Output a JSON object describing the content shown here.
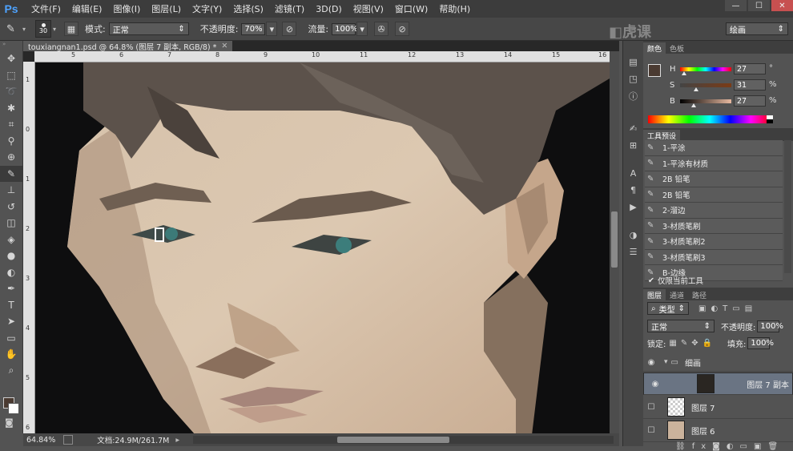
{
  "app": {
    "logo": "Ps"
  },
  "menu": [
    "文件(F)",
    "编辑(E)",
    "图像(I)",
    "图层(L)",
    "文字(Y)",
    "选择(S)",
    "滤镜(T)",
    "3D(D)",
    "视图(V)",
    "窗口(W)",
    "帮助(H)"
  ],
  "window_controls": [
    "—",
    "☐",
    "✕"
  ],
  "options": {
    "brush_size": "30",
    "mode_label": "模式:",
    "mode_value": "正常",
    "opacity_label": "不透明度:",
    "opacity_value": "70%",
    "flow_label": "流量:",
    "flow_value": "100%",
    "workspace": "绘画"
  },
  "document": {
    "tab_title": "touxiangnan1.psd @ 64.8% (图层 7 副本, RGB/8) *",
    "ruler_h": [
      "5",
      "6",
      "7",
      "8",
      "9",
      "10",
      "11",
      "12",
      "13",
      "14",
      "15",
      "16"
    ],
    "ruler_v": [
      "1",
      "0",
      "1",
      "2",
      "3",
      "4",
      "5",
      "6"
    ]
  },
  "status": {
    "zoom": "64.84%",
    "doc_size": "文档:24.9M/261.7M"
  },
  "color_panel": {
    "tabs": [
      "颜色",
      "色板"
    ],
    "h": {
      "label": "H",
      "value": "27",
      "unit": "°",
      "fraction": 0.08
    },
    "s": {
      "label": "S",
      "value": "31",
      "unit": "%",
      "fraction": 0.31
    },
    "b": {
      "label": "B",
      "value": "27",
      "unit": "%",
      "fraction": 0.27
    },
    "foreground": "#4a3a31"
  },
  "tool_presets": {
    "title": "工具预设",
    "items": [
      "1-平涂",
      "1-平涂有材质",
      "2B 铅笔",
      "2B 铅笔",
      "2-溜边",
      "3-材质笔刷",
      "3-材质笔刷2",
      "3-材质笔刷3",
      "B-边缘"
    ],
    "current_only": "仅限当前工具"
  },
  "layers_panel": {
    "tabs": [
      "图层",
      "通道",
      "路径"
    ],
    "filter": "类型",
    "blend": "正常",
    "opacity_label": "不透明度:",
    "opacity_value": "100%",
    "lock_label": "锁定:",
    "fill_label": "填充:",
    "fill_value": "100%",
    "group": "细画",
    "layers": [
      {
        "name": "图层 7 副本",
        "visible": true,
        "selected": true
      },
      {
        "name": "图层 7",
        "visible": false,
        "selected": false
      },
      {
        "name": "图层 6",
        "visible": false,
        "selected": false
      }
    ]
  }
}
